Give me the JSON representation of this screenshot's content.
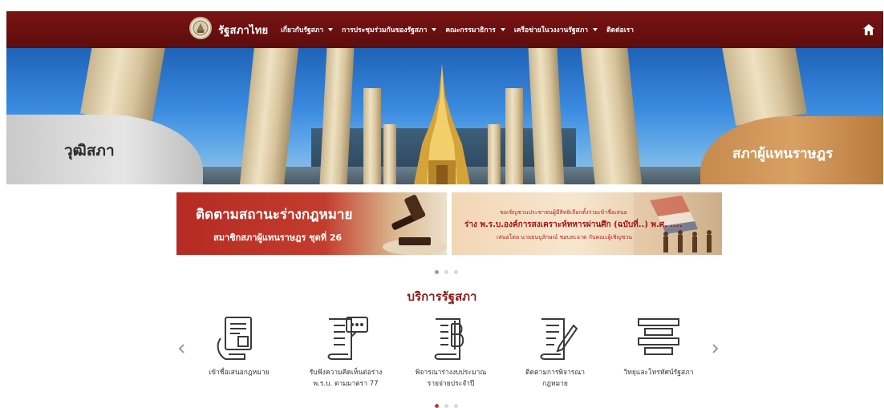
{
  "header": {
    "brand": "รัฐสภาไทย",
    "menu": [
      {
        "label": "เกี่ยวกับรัฐสภา",
        "has_dropdown": true
      },
      {
        "label": "การประชุมร่วมกันของรัฐสภา",
        "has_dropdown": true
      },
      {
        "label": "คณะกรรมาธิการ",
        "has_dropdown": true
      },
      {
        "label": "เครือข่ายในวงงานรัฐสภา",
        "has_dropdown": true
      },
      {
        "label": "ติดต่อเรา",
        "has_dropdown": false
      }
    ],
    "home_icon": "home-icon",
    "bg_color": "#6b1010"
  },
  "hero": {
    "left_label": "วุฒิสภา",
    "right_label": "สภาผู้แทนราษฎร"
  },
  "banners": [
    {
      "title": "ติดตามสถานะร่างกฎหมาย",
      "subtitle": "สมาชิกสภาผู้แทนราษฎร ชุดที่ 26"
    },
    {
      "line1": "ขอเชิญชวนประชาชนผู้มีสิทธิเลือกตั้งร่วมเข้าชื่อเสนอ",
      "line2": "ร่าง พ.ร.บ.องค์การสงเคราะห์ทหารผ่านศึก (ฉบับที่..) พ.ศ. ....",
      "line3": "เสนอโดย นายธนบูลักษณ์ ชอบสะอาด กับคณะผู้เชิญชวน"
    }
  ],
  "services": {
    "title": "บริการรัฐสภา",
    "items": [
      {
        "line1": "เข้าชื่อเสนอกฎหมาย",
        "line2": "",
        "icon": "document-hand-icon"
      },
      {
        "line1": "รับฟังความคิดเห็นต่อร่าง",
        "line2": "พ.ร.บ. ตามมาตรา 77",
        "icon": "document-comment-icon"
      },
      {
        "line1": "พิจารณาร่างงบประมาณ",
        "line2": "รายจ่ายประจำปี",
        "icon": "document-baht-icon"
      },
      {
        "line1": "ติดตามการพิจารณา",
        "line2": "กฎหมาย",
        "icon": "document-pen-icon"
      },
      {
        "line1": "วิทยุและโทรทัศน์รัฐสภา",
        "line2": "",
        "icon": "broadcast-icon"
      }
    ],
    "prev_icon": "chevron-left-icon",
    "next_icon": "chevron-right-icon"
  }
}
